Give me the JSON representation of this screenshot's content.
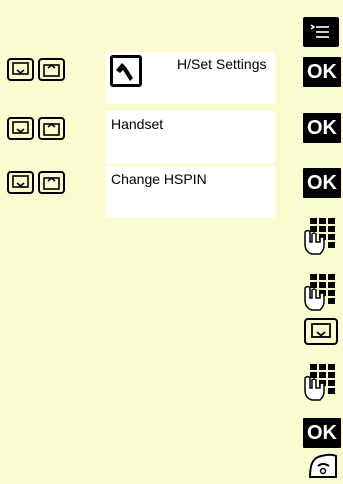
{
  "rows": [
    {
      "id": "settings",
      "label": "H/Set Settings",
      "icon": "wrench-icon",
      "ok": "OK"
    },
    {
      "id": "handset",
      "label": "Handset",
      "ok": "OK"
    },
    {
      "id": "changepin",
      "label": "Change HSPIN",
      "ok": "OK"
    }
  ],
  "side": {
    "menu_icon": "menu-icon",
    "keypad_icon": "keypad-hand-icon",
    "nav_down_icon": "nav-down-icon",
    "ok_final": "OK",
    "end_call_icon": "end-call-icon"
  }
}
